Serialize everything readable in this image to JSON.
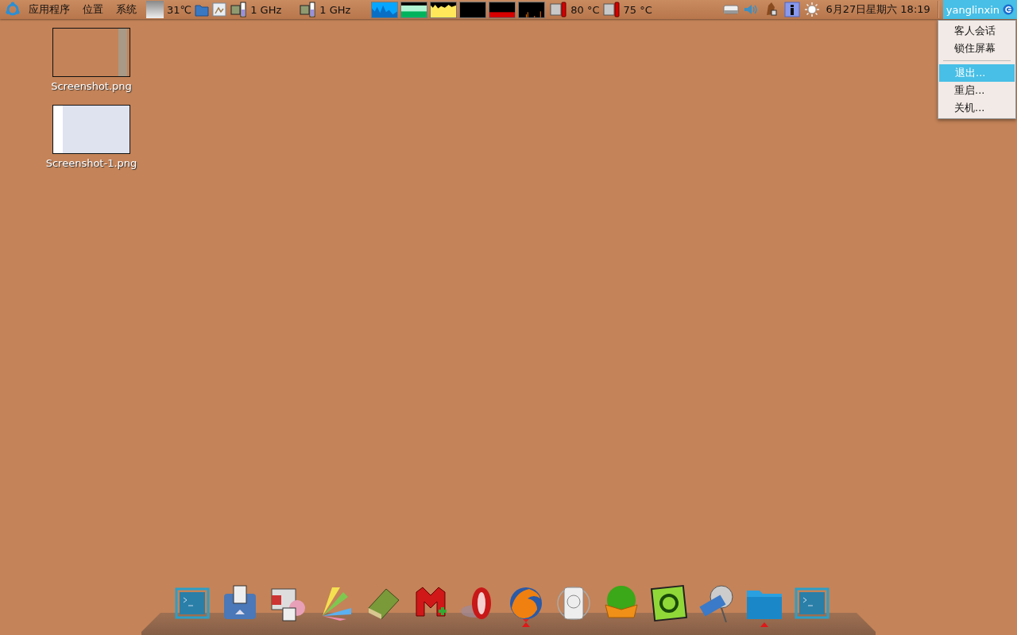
{
  "panel": {
    "menus": [
      {
        "label": "应用程序"
      },
      {
        "label": "位置"
      },
      {
        "label": "系统"
      }
    ],
    "weather": {
      "temperature": "31℃"
    },
    "cpu_freq": [
      "1 GHz",
      "1 GHz"
    ],
    "temperatures": [
      "80 °C",
      "75 °C"
    ],
    "clock": "6月27日星期六 18:19",
    "user": {
      "label": "yanglinxin",
      "selected": true
    }
  },
  "user_menu": [
    {
      "kind": "item",
      "label": "客人会话",
      "selected": false
    },
    {
      "kind": "item",
      "label": "锁住屏幕",
      "selected": false
    },
    {
      "kind": "separator"
    },
    {
      "kind": "item",
      "label": "退出...",
      "selected": true
    },
    {
      "kind": "item",
      "label": "重启...",
      "selected": false
    },
    {
      "kind": "item",
      "label": "关机...",
      "selected": false
    }
  ],
  "desktop_icons": [
    {
      "label": "Screenshot.png"
    },
    {
      "label": "Screenshot-1.png"
    }
  ],
  "dock": [
    {
      "running": false
    },
    {
      "running": false
    },
    {
      "running": false
    },
    {
      "running": false
    },
    {
      "running": false
    },
    {
      "running": false
    },
    {
      "running": false
    },
    {
      "running": true
    },
    {
      "running": false
    },
    {
      "running": false
    },
    {
      "running": false
    },
    {
      "running": false
    },
    {
      "running": true
    },
    {
      "running": false
    }
  ]
}
